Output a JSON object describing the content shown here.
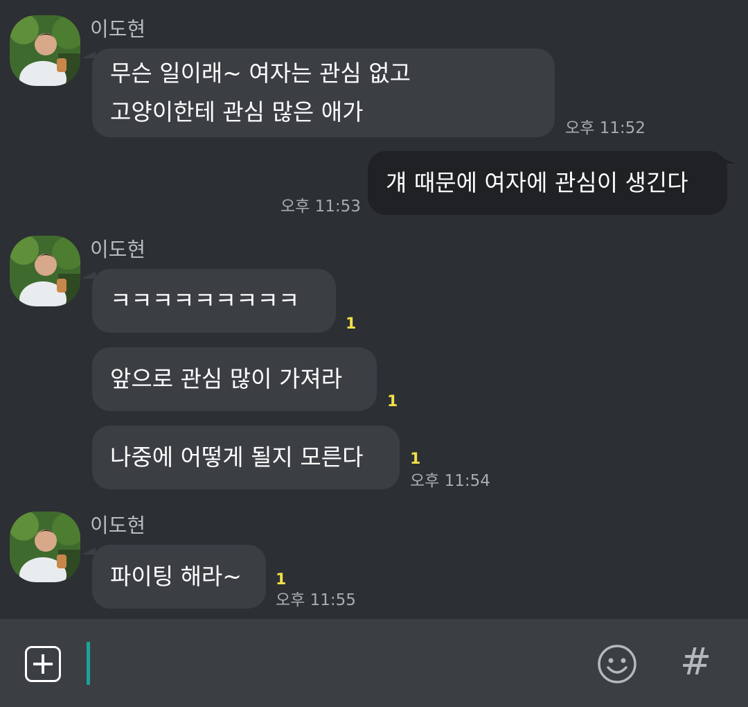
{
  "sender_name": "이도현",
  "messages": [
    {
      "text_lines": [
        "무슨 일이래~ 여자는 관심 없고",
        "고양이한테 관심 많은 애가"
      ],
      "time": "오후 11:52"
    },
    {
      "text": "걔 때문에 여자에 관심이 생긴다",
      "time": "오후 11:53"
    },
    {
      "text": "ㅋㅋㅋㅋㅋㅋㅋㅋㅋ",
      "unread": "1"
    },
    {
      "text": "앞으로 관심 많이 가져라",
      "unread": "1"
    },
    {
      "text": "나중에 어떻게 될지 모른다",
      "unread": "1",
      "time": "오후 11:54"
    },
    {
      "text": "파이팅 해라~",
      "unread": "1",
      "time": "오후 11:55"
    }
  ],
  "input": {
    "plus_icon": "plus-square-icon",
    "emoji_icon": "smiley-icon",
    "hash_label": "#"
  },
  "colors": {
    "background": "#2c2f33",
    "bubble": "#3b3e43",
    "my_bubble": "#1f2124",
    "unread": "#f1e04a",
    "cursor": "#1aa39a"
  }
}
